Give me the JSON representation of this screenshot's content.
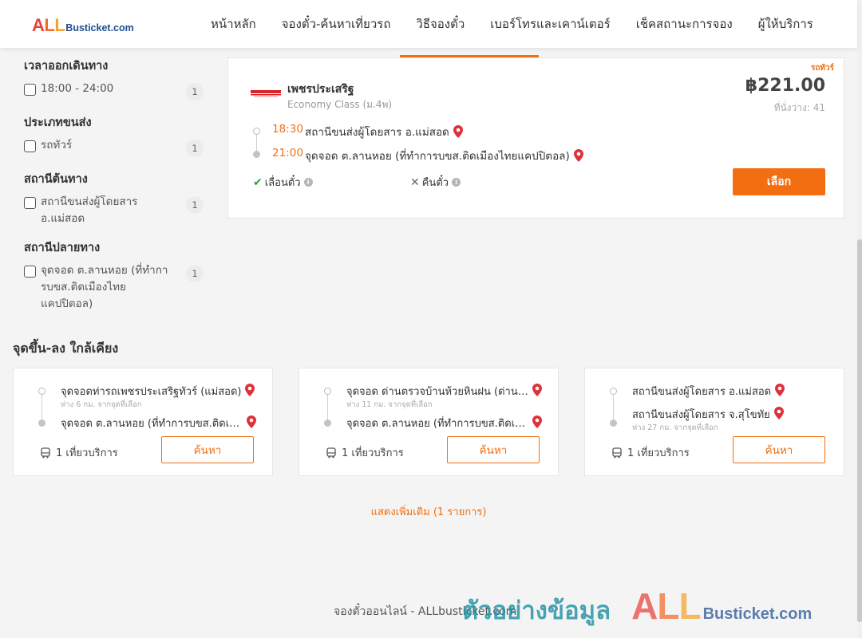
{
  "header": {
    "logo_all": [
      "A",
      "L",
      "L"
    ],
    "logo_rest": "Busticket.com",
    "nav": [
      "หน้าหลัก",
      "จองตั๋ว-ค้นหาเที่ยวรถ",
      "วิธีจองตั๋ว",
      "เบอร์โทรและเคาน์เตอร์",
      "เช็คสถานะการจอง",
      "ผู้ให้บริการ"
    ]
  },
  "filters": {
    "departure_time": {
      "title": "เวลาออกเดินทาง",
      "options": [
        {
          "label": "18:00 - 24:00",
          "count": "1",
          "checked": false
        }
      ]
    },
    "transport_type": {
      "title": "ประเภทขนส่ง",
      "options": [
        {
          "label": "รถทัวร์",
          "count": "1",
          "checked": false
        }
      ]
    },
    "origin": {
      "title": "สถานีต้นทาง",
      "options": [
        {
          "label": "สถานีขนส่งผู้โดยสาร อ.แม่สอด",
          "count": "1",
          "checked": false
        }
      ]
    },
    "destination": {
      "title": "สถานีปลายทาง",
      "options": [
        {
          "label": "จุดจอด ต.ลานหอย (ที่ทำการบขส.ติดเมืองไทยแคปปิตอล)",
          "count": "1",
          "checked": false
        }
      ]
    }
  },
  "result": {
    "tag": "รถทัวร์",
    "operator_name": "เพชรประเสริฐ",
    "class": "Economy Class (ม.4พ)",
    "price": "฿221.00",
    "seats": "ที่นั่งว่าง: 41",
    "departure_time": "18:30",
    "departure_stop": "สถานีขนส่งผู้โดยสาร อ.แม่สอด",
    "arrival_time": "21:00",
    "arrival_stop": "จุดจอด ต.ลานหอย (ที่ทำการบขส.ติดเมืองไทยแคปปิตอล)",
    "feature_reschedule": "เลื่อนตั๋ว",
    "feature_refund": "คืนตั๋ว",
    "select_label": "เลือก"
  },
  "nearby": {
    "title": "จุดขึ้น-ลง ใกล้เคียง",
    "cards": [
      {
        "from": "จุดจอดท่ารถเพชรประเสริฐทัวร์ (แม่สอด)",
        "from_dist": "ห่าง 6 กม. จากจุดที่เลือก",
        "to": "จุดจอด ต.ลานหอย (ที่ทำการบขส.ติดเมืองไทยแคปปิตอล)",
        "to_dist": "",
        "trips": "1 เที่ยวบริการ",
        "search_label": "ค้นหา"
      },
      {
        "from": "จุดจอด ด่านตรวจบ้านห้วยหินฝน (ด่านตรวจ)",
        "from_dist": "ห่าง 11 กม. จากจุดที่เลือก",
        "to": "จุดจอด ต.ลานหอย (ที่ทำการบขส.ติดเมืองไทยแคปปิตอล)",
        "to_dist": "",
        "trips": "1 เที่ยวบริการ",
        "search_label": "ค้นหา"
      },
      {
        "from": "สถานีขนส่งผู้โดยสาร อ.แม่สอด",
        "from_dist": "",
        "to": "สถานีขนส่งผู้โดยสาร จ.สุโขทัย",
        "to_dist": "ห่าง 27 กม. จากจุดที่เลือก",
        "trips": "1 เที่ยวบริการ",
        "search_label": "ค้นหา"
      }
    ],
    "show_more": "แสดงเพิ่มเติม (1 รายการ)"
  },
  "footer": {
    "text": "จองตั๋วออนไลน์ - ALLbusticket.com"
  },
  "watermark": {
    "thai": "ตัวอย่างข้อมูล",
    "all": [
      "A",
      "L",
      "L"
    ],
    "rest": "Busticket.com"
  },
  "colors": {
    "accent": "#f26e11",
    "pin": "#e0303a",
    "check": "#2e9e3e"
  }
}
